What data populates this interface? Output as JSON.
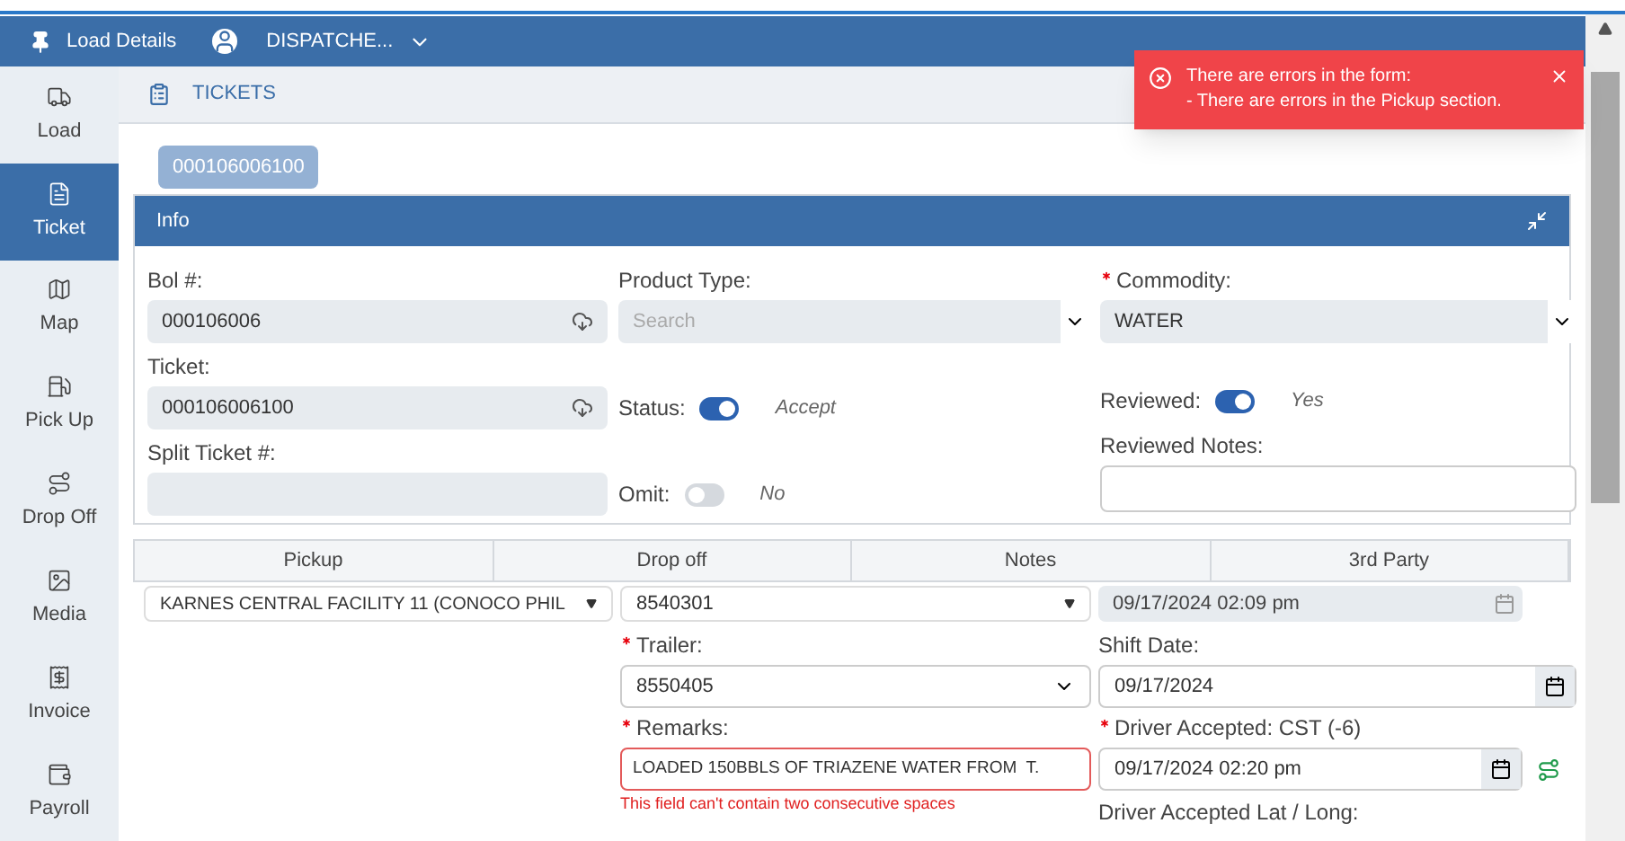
{
  "header": {
    "title": "Load Details",
    "user": "DISPATCHE..."
  },
  "sidebar": {
    "items": [
      {
        "label": "Load",
        "selected": false
      },
      {
        "label": "Ticket",
        "selected": true
      },
      {
        "label": "Map",
        "selected": false
      },
      {
        "label": "Pick Up",
        "selected": false
      },
      {
        "label": "Drop Off",
        "selected": false
      },
      {
        "label": "Media",
        "selected": false
      },
      {
        "label": "Invoice",
        "selected": false
      },
      {
        "label": "Payroll",
        "selected": false
      }
    ]
  },
  "section_title": "TICKETS",
  "ticket_chip": "000106006100",
  "alert": {
    "title": "There are errors in the form:",
    "message": "- There are errors in the Pickup section."
  },
  "info": {
    "title": "Info",
    "bol": {
      "label": "Bol #:",
      "value": "000106006"
    },
    "product_type": {
      "label": "Product Type:",
      "placeholder": "Search"
    },
    "commodity": {
      "label": "Commodity:",
      "value": "WATER",
      "required": true
    },
    "ticket": {
      "label": "Ticket:",
      "value": "000106006100"
    },
    "status": {
      "label": "Status:",
      "on": true,
      "text": "Accept"
    },
    "reviewed": {
      "label": "Reviewed:",
      "on": true,
      "text": "Yes"
    },
    "split_ticket": {
      "label": "Split Ticket #:"
    },
    "reviewed_notes": {
      "label": "Reviewed Notes:"
    },
    "omit": {
      "label": "Omit:",
      "on": false,
      "text": "No"
    }
  },
  "tabs": [
    {
      "label": "Pickup"
    },
    {
      "label": "Drop off"
    },
    {
      "label": "Notes"
    },
    {
      "label": "3rd Party"
    }
  ],
  "pickup": {
    "origin": {
      "value": "KARNES CENTRAL FACILITY 11 (CONOCO PHIL"
    },
    "truck": {
      "value": "8540301"
    },
    "date": {
      "value": "09/17/2024 02:09 pm"
    },
    "trailer": {
      "label": "Trailer:",
      "value": "8550405",
      "required": true
    },
    "shift_date": {
      "label": "Shift Date:",
      "value": "09/17/2024"
    },
    "remarks": {
      "label": "Remarks:",
      "value": "LOADED 150BBLS OF TRIAZENE WATER FROM  T.",
      "required": true,
      "error": "This field can't contain two consecutive spaces"
    },
    "driver_accepted": {
      "label": "Driver Accepted: CST (-6)",
      "value": "09/17/2024 02:20 pm",
      "required": true
    },
    "lat_long": {
      "label": "Driver Accepted Lat / Long:"
    }
  }
}
